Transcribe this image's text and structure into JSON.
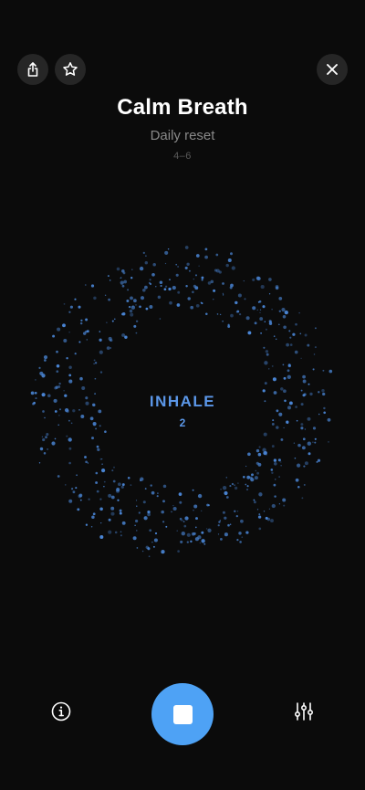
{
  "header": {
    "title": "Calm Breath",
    "subtitle": "Daily reset",
    "pattern": "4–6"
  },
  "toolbar": {
    "left_icons": [
      "share-icon",
      "star-icon"
    ],
    "right_icon": "close-icon"
  },
  "breath": {
    "phase": "INHALE",
    "count": "2"
  },
  "controls": {
    "left_icon": "info-icon",
    "primary_icon": "stop-icon",
    "right_icon": "sliders-icon"
  },
  "colors": {
    "background": "#0b0b0b",
    "accent": "#4ea2f5",
    "particle": "#4a86d6",
    "phase_text": "#5b97e8",
    "button_bg": "#262626"
  }
}
